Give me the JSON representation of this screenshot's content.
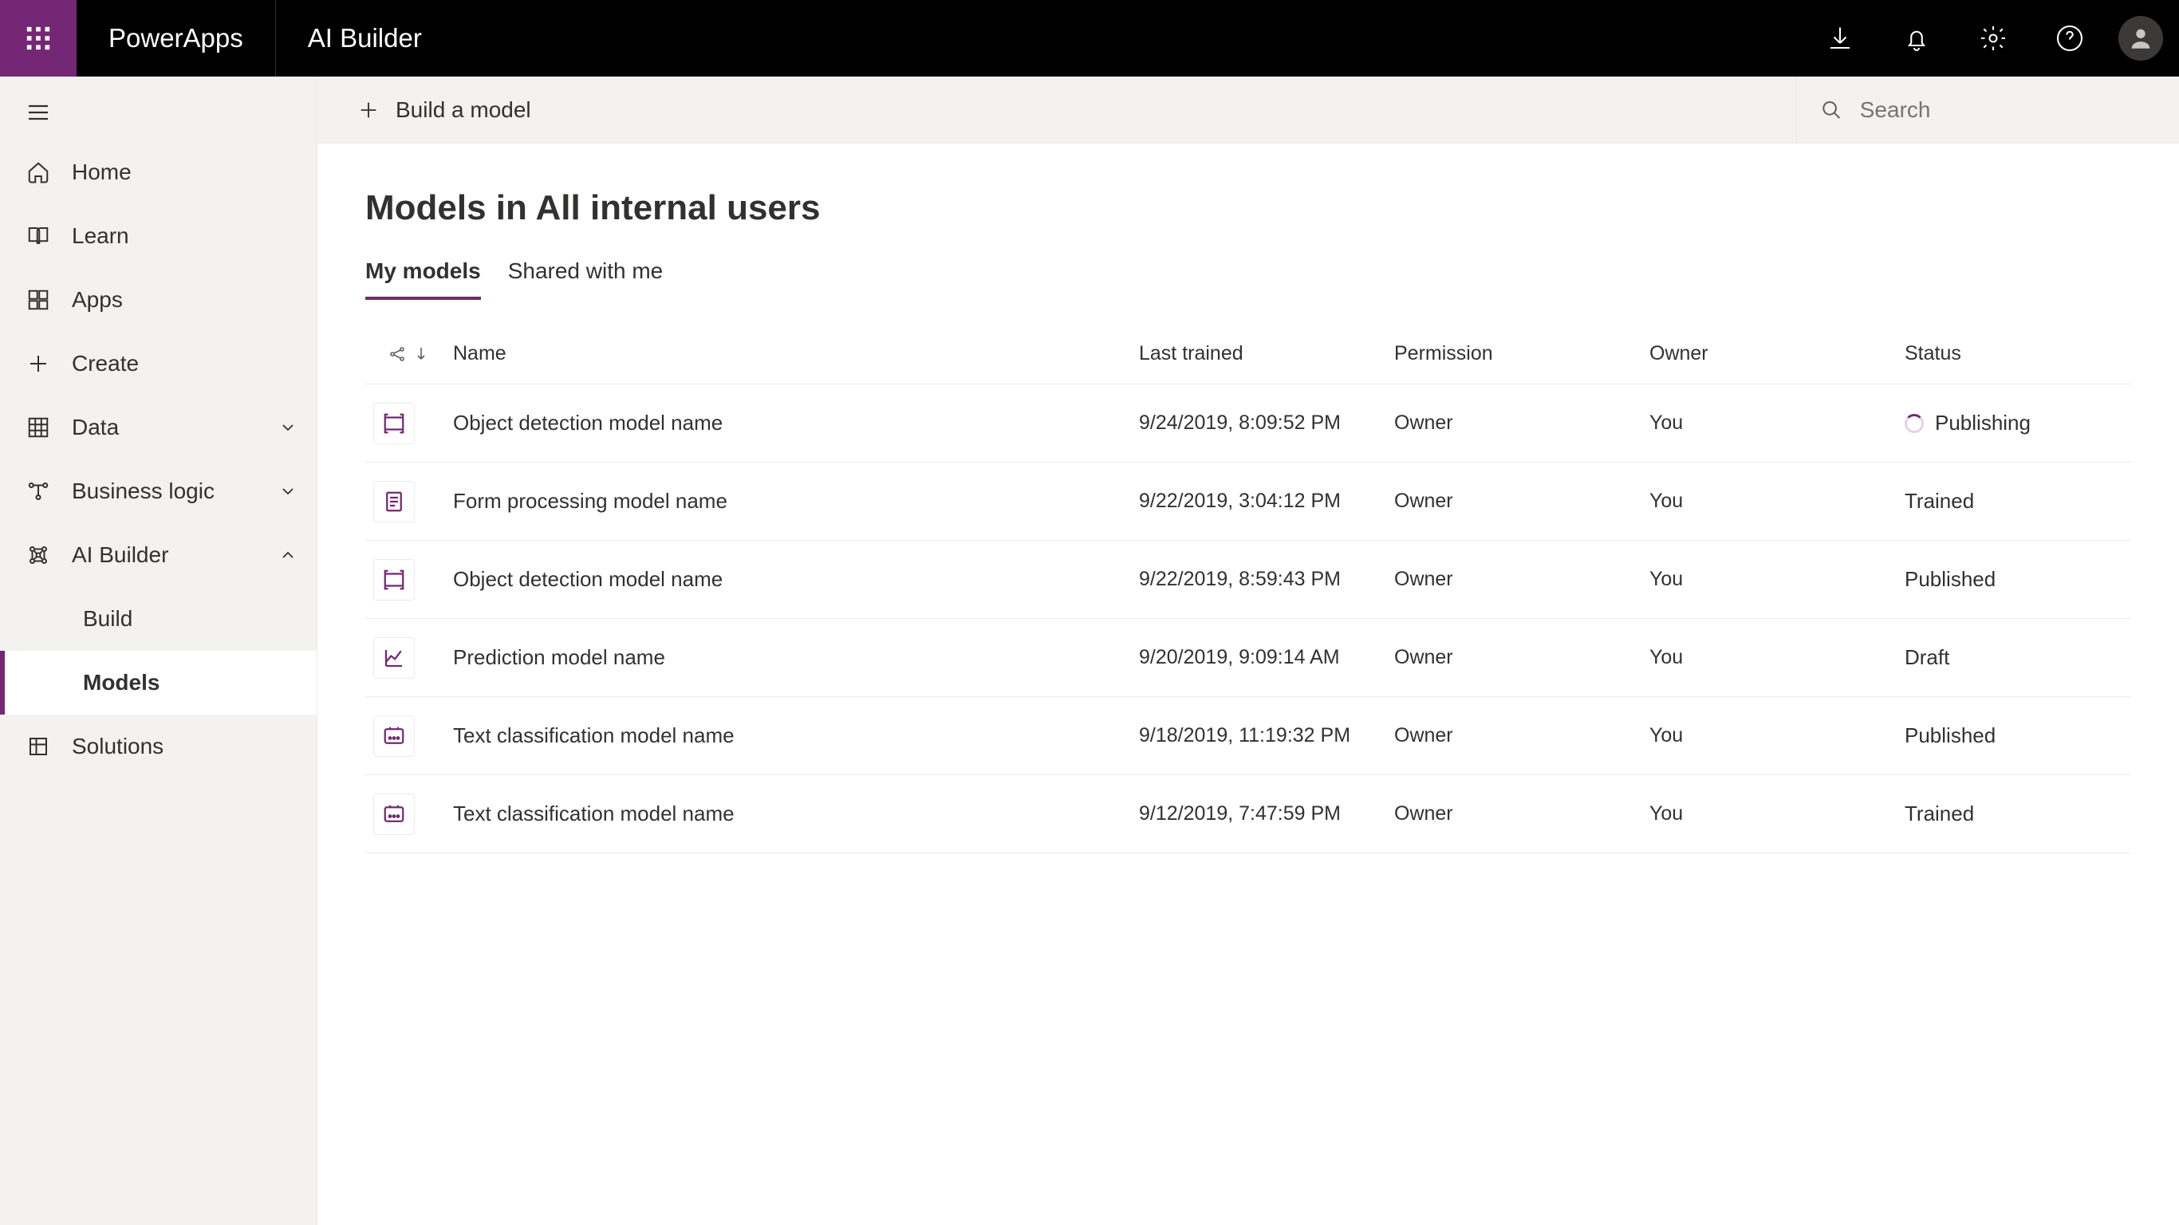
{
  "header": {
    "app_name": "PowerApps",
    "section": "AI Builder"
  },
  "sidebar": {
    "items": [
      {
        "label": "Home"
      },
      {
        "label": "Learn"
      },
      {
        "label": "Apps"
      },
      {
        "label": "Create"
      },
      {
        "label": "Data"
      },
      {
        "label": "Business logic"
      },
      {
        "label": "AI Builder"
      },
      {
        "label": "Solutions"
      }
    ],
    "ai_builder_children": [
      {
        "label": "Build"
      },
      {
        "label": "Models"
      }
    ]
  },
  "cmdbar": {
    "build_label": "Build a model",
    "search_placeholder": "Search"
  },
  "page": {
    "title": "Models in All internal users"
  },
  "tabs": [
    {
      "label": "My models",
      "active": true
    },
    {
      "label": "Shared with me",
      "active": false
    }
  ],
  "columns": {
    "name": "Name",
    "last_trained": "Last trained",
    "permission": "Permission",
    "owner": "Owner",
    "status": "Status"
  },
  "rows": [
    {
      "type": "object-detection",
      "name": "Object detection model name",
      "last_trained": "9/24/2019, 8:09:52 PM",
      "permission": "Owner",
      "owner": "You",
      "status": "Publishing",
      "spinner": true
    },
    {
      "type": "form-processing",
      "name": "Form processing model name",
      "last_trained": "9/22/2019, 3:04:12 PM",
      "permission": "Owner",
      "owner": "You",
      "status": "Trained",
      "spinner": false
    },
    {
      "type": "object-detection",
      "name": "Object detection model name",
      "last_trained": "9/22/2019, 8:59:43 PM",
      "permission": "Owner",
      "owner": "You",
      "status": "Published",
      "spinner": false
    },
    {
      "type": "prediction",
      "name": "Prediction model name",
      "last_trained": "9/20/2019, 9:09:14 AM",
      "permission": "Owner",
      "owner": "You",
      "status": "Draft",
      "spinner": false
    },
    {
      "type": "text-classification",
      "name": "Text classification model name",
      "last_trained": "9/18/2019, 11:19:32 PM",
      "permission": "Owner",
      "owner": "You",
      "status": "Published",
      "spinner": false
    },
    {
      "type": "text-classification",
      "name": "Text classification model name",
      "last_trained": "9/12/2019, 7:47:59 PM",
      "permission": "Owner",
      "owner": "You",
      "status": "Trained",
      "spinner": false
    }
  ]
}
